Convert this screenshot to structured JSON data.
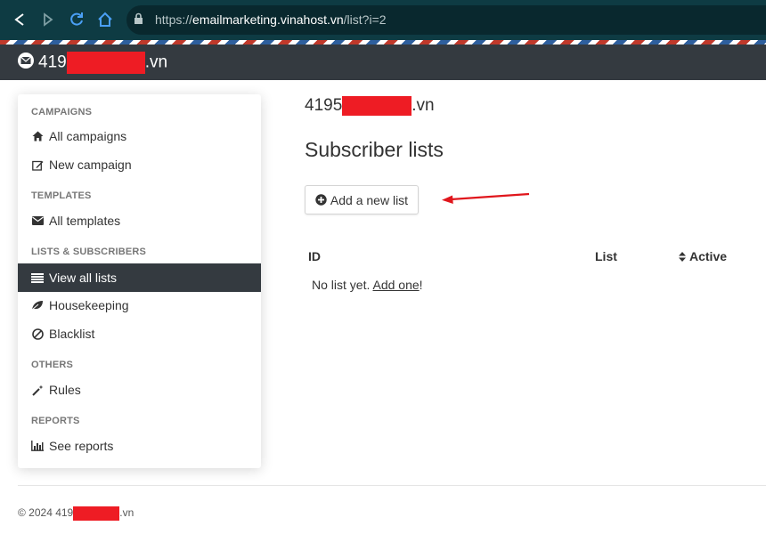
{
  "browser": {
    "url_prefix": "https://",
    "url_host": "emailmarketing.vinahost.vn",
    "url_path": "/list?i=2"
  },
  "header": {
    "brand_prefix": "419",
    "brand_suffix": ".vn"
  },
  "sidebar": {
    "sections": {
      "campaigns": "CAMPAIGNS",
      "templates": "TEMPLATES",
      "lists": "LISTS & SUBSCRIBERS",
      "others": "OTHERS",
      "reports": "REPORTS"
    },
    "items": {
      "all_campaigns": "All campaigns",
      "new_campaign": "New campaign",
      "all_templates": "All templates",
      "view_all_lists": "View all lists",
      "housekeeping": "Housekeeping",
      "blacklist": "Blacklist",
      "rules": "Rules",
      "see_reports": "See reports"
    },
    "active_item": "view_all_lists"
  },
  "main": {
    "site_prefix": "4195",
    "site_suffix": ".vn",
    "title": "Subscriber lists",
    "add_button": "Add a new list",
    "table": {
      "columns": [
        "ID",
        "List",
        "Active"
      ]
    },
    "empty_text": "No list yet.",
    "empty_link": "Add one",
    "empty_after": "!"
  },
  "footer": {
    "prefix": "© 2024 419",
    "suffix": ".vn"
  },
  "icons": {
    "back": "back-arrow-icon",
    "forward": "forward-arrow-icon",
    "reload": "reload-icon",
    "home": "home-icon",
    "lock": "lock-icon",
    "brand": "envelope-logo-icon",
    "add": "plus-circle-icon",
    "sort": "sort-icon"
  },
  "colors": {
    "header_bg": "#343a40",
    "browser_bg": "#0e3b43",
    "active_bg": "#343a40",
    "redaction": "#ee1c24",
    "annotation_arrow": "#e0161c"
  }
}
